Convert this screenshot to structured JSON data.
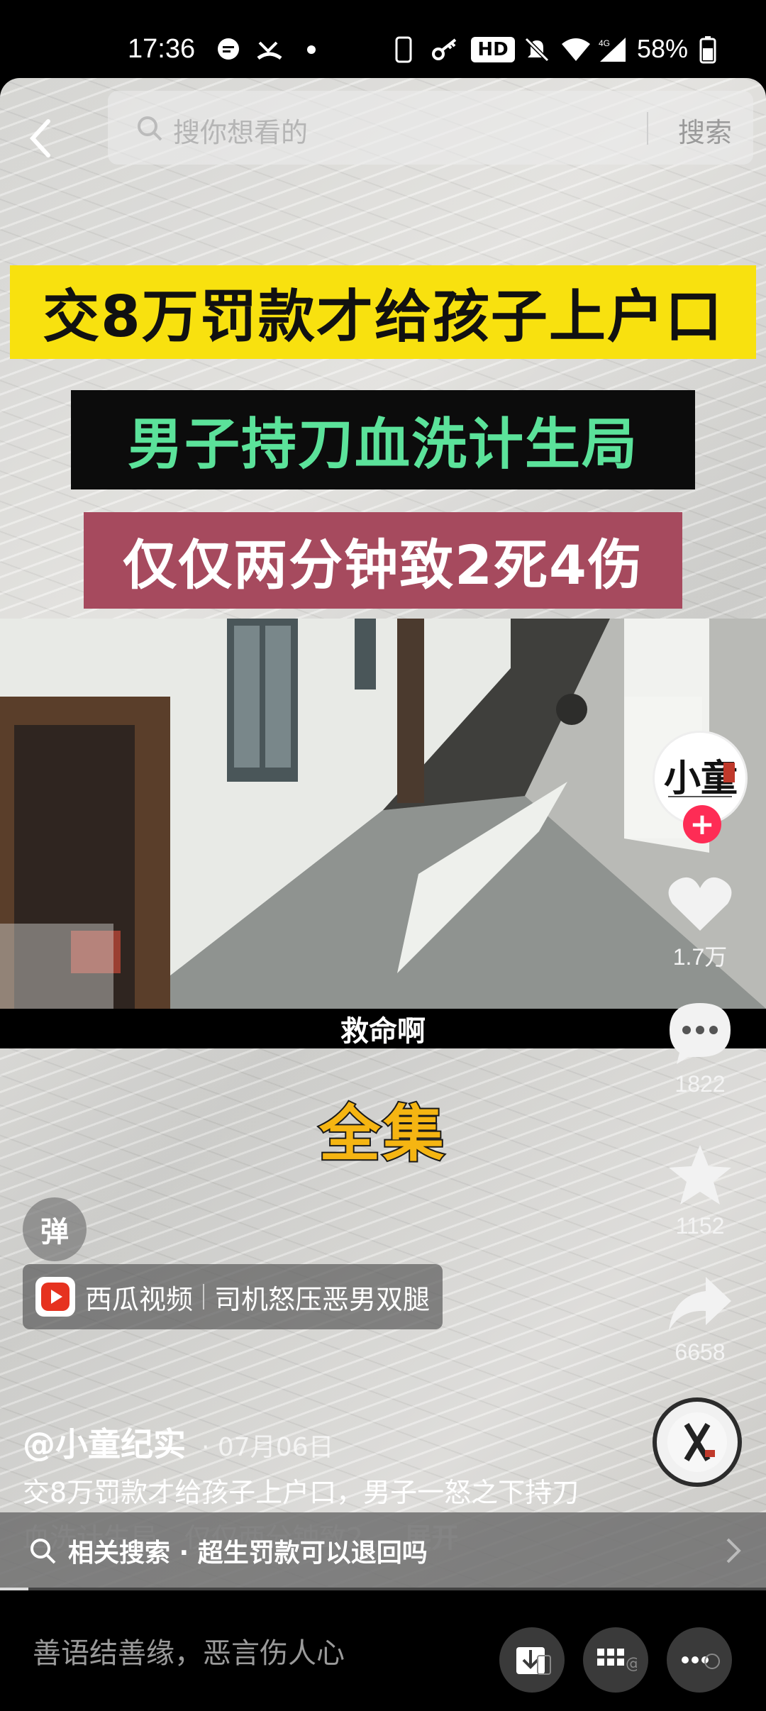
{
  "status_bar": {
    "time": "17:36",
    "battery": "58%",
    "network": "4G",
    "hd_badge": "HD"
  },
  "search": {
    "placeholder": "搜你想看的",
    "button_label": "搜索"
  },
  "video": {
    "headline_1": "交8万罚款才给孩子上户口",
    "headline_2": "男子持刀血洗计生局",
    "headline_3": "仅仅两分钟致2死4伤",
    "subtitle": "救命啊",
    "collection_label": "全集"
  },
  "danmaku_label": "弹",
  "rail": {
    "avatar_text": "小童",
    "follow_label": "+",
    "likes": "1.7万",
    "comments": "1822",
    "favorites": "1152",
    "shares": "6658"
  },
  "source": {
    "app": "西瓜视频",
    "title": "司机怒压恶男双腿"
  },
  "post": {
    "author": "@小童纪实",
    "date": "· 07月06日",
    "description": "交8万罚款才给孩子上户口，男子一怒之下持刀血洗计生局，仅仅两分钟致2...",
    "expand_label": "展开"
  },
  "related_search": {
    "text": "相关搜索 · 超生罚款可以退回吗"
  },
  "bottom": {
    "comment_placeholder": "善语结善缘，恶言伤人心"
  },
  "colors": {
    "banner_yellow": "#f8e10f",
    "banner_green_text": "#5be29a",
    "banner_red": "#a64a5e",
    "follow_red": "#fe2c55",
    "collection_gold": "#f5b512"
  }
}
